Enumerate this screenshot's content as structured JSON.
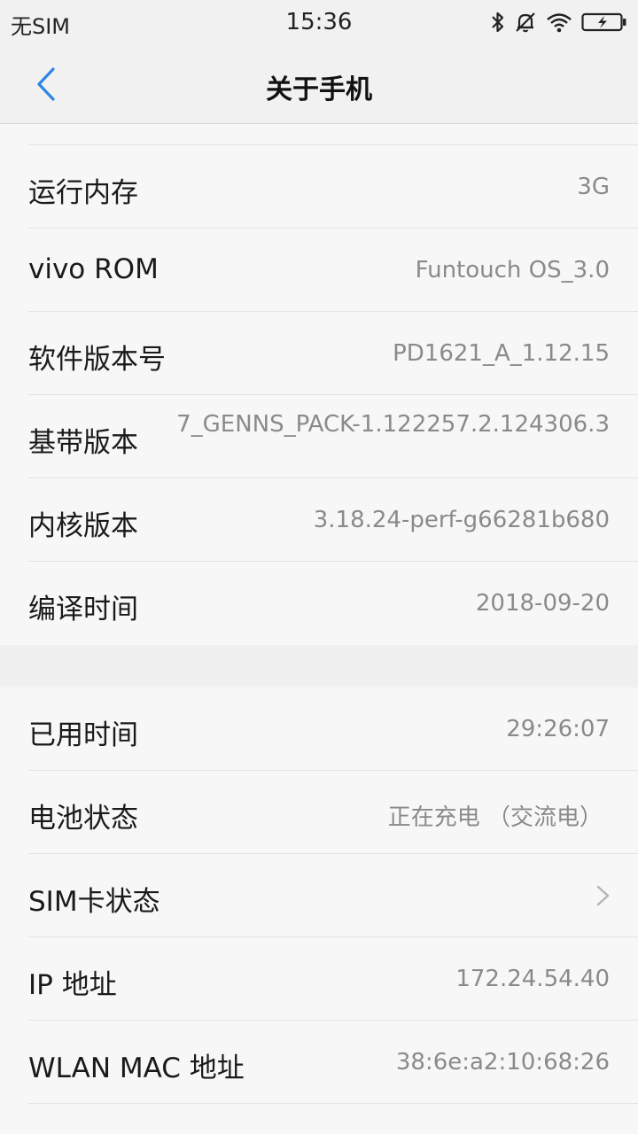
{
  "status_bar": {
    "carrier": "无SIM",
    "time": "15:36",
    "icons": [
      "bluetooth-icon",
      "mute-icon",
      "wifi-icon",
      "battery-charging-icon"
    ]
  },
  "header": {
    "title": "关于手机",
    "back_icon": "back-arrow-icon"
  },
  "section1": [
    {
      "label": "运行内存",
      "value": "3G"
    },
    {
      "label": "vivo ROM",
      "value": "Funtouch OS_3.0"
    },
    {
      "label": "软件版本号",
      "value": "PD1621_A_1.12.15"
    },
    {
      "label": "基带版本",
      "value": "7_GENNS_PACK-1.122257.2.124306.3"
    },
    {
      "label": "内核版本",
      "value": "3.18.24-perf-g66281b680"
    },
    {
      "label": "编译时间",
      "value": "2018-09-20"
    }
  ],
  "section2": [
    {
      "label": "已用时间",
      "value": "29:26:07"
    },
    {
      "label": "电池状态",
      "value": "正在充电 （交流电）"
    },
    {
      "label": "SIM卡状态",
      "value": ""
    },
    {
      "label": "IP 地址",
      "value": "172.24.54.40"
    },
    {
      "label": "WLAN MAC 地址",
      "value": "38:6e:a2:10:68:26"
    }
  ],
  "colors": {
    "accent": "#2f86e0",
    "label": "#1a1a1a",
    "value": "#8a8a8a",
    "divider": "#e2e2e2"
  }
}
